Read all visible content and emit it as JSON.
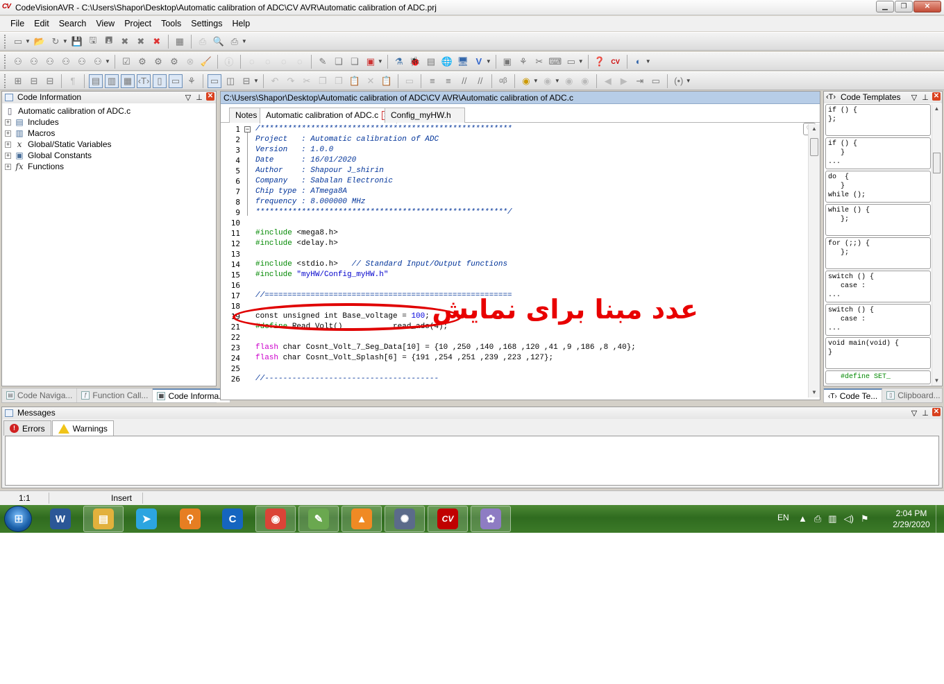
{
  "window": {
    "title": "CodeVisionAVR - C:\\Users\\Shapor\\Desktop\\Automatic calibration of ADC\\CV AVR\\Automatic calibration of ADC.prj",
    "app_icon_text": "CV"
  },
  "menu": [
    "File",
    "Edit",
    "Search",
    "View",
    "Project",
    "Tools",
    "Settings",
    "Help"
  ],
  "code_info_panel": {
    "title": "Code Information",
    "root": "Automatic calibration of ADC.c",
    "items": [
      {
        "label": "Includes",
        "icon": "includes-icon"
      },
      {
        "label": "Macros",
        "icon": "macros-icon"
      },
      {
        "label": "Global/Static Variables",
        "icon": "variable-icon",
        "glyph": "x"
      },
      {
        "label": "Global Constants",
        "icon": "constants-icon"
      },
      {
        "label": "Functions",
        "icon": "function-icon",
        "glyph": "fx"
      }
    ],
    "bottom_tabs": [
      "Code Naviga...",
      "Function Call...",
      "Code Informa..."
    ]
  },
  "editor": {
    "path": "C:\\Users\\Shapor\\Desktop\\Automatic calibration of ADC\\CV AVR\\Automatic calibration of ADC.c",
    "tabs": [
      "Notes",
      "Automatic calibration of ADC.c",
      "Config_myHW.h"
    ],
    "line_numbers": [
      "1",
      "2",
      "3",
      "4",
      "5",
      "6",
      "7",
      "8",
      "9",
      "10",
      "11",
      "12",
      "13",
      "14",
      "15",
      "16",
      "17",
      "18",
      "19",
      "21",
      "22",
      "23",
      "24",
      "25",
      "26"
    ],
    "lines": [
      {
        "n": "1",
        "parts": [
          {
            "t": "/*******************************************************",
            "c": "cmt"
          }
        ]
      },
      {
        "n": "2",
        "parts": [
          {
            "t": "Project   : Automatic calibration of ADC",
            "c": "cmt"
          }
        ]
      },
      {
        "n": "3",
        "parts": [
          {
            "t": "Version   : 1.0.0",
            "c": "cmt"
          }
        ]
      },
      {
        "n": "4",
        "parts": [
          {
            "t": "Date      : 16/01/2020",
            "c": "cmt"
          }
        ]
      },
      {
        "n": "5",
        "parts": [
          {
            "t": "Author    : Shapour J_shirin",
            "c": "cmt"
          }
        ]
      },
      {
        "n": "6",
        "parts": [
          {
            "t": "Company   : Sabalan Electronic",
            "c": "cmt"
          }
        ]
      },
      {
        "n": "7",
        "parts": [
          {
            "t": "Chip type : ATmega8A",
            "c": "cmt"
          }
        ]
      },
      {
        "n": "8",
        "parts": [
          {
            "t": "frequency : 8.000000 MHz",
            "c": "cmt"
          }
        ]
      },
      {
        "n": "9",
        "parts": [
          {
            "t": "*******************************************************/",
            "c": "cmt"
          }
        ]
      },
      {
        "n": "10",
        "parts": []
      },
      {
        "n": "11",
        "parts": [
          {
            "t": "#include ",
            "c": "dir"
          },
          {
            "t": "<mega8.h>",
            "c": ""
          }
        ]
      },
      {
        "n": "12",
        "parts": [
          {
            "t": "#include ",
            "c": "dir"
          },
          {
            "t": "<delay.h>",
            "c": ""
          }
        ]
      },
      {
        "n": "13",
        "parts": []
      },
      {
        "n": "14",
        "parts": [
          {
            "t": "#include ",
            "c": "dir"
          },
          {
            "t": "<stdio.h>   ",
            "c": ""
          },
          {
            "t": "// Standard Input/Output functions",
            "c": "cmt"
          }
        ]
      },
      {
        "n": "15",
        "parts": [
          {
            "t": "#include ",
            "c": "dir"
          },
          {
            "t": "\"myHW/Config_myHW.h\"",
            "c": "str"
          }
        ]
      },
      {
        "n": "16",
        "parts": []
      },
      {
        "n": "17",
        "parts": [
          {
            "t": "//======================================================",
            "c": "cmt"
          }
        ]
      },
      {
        "n": "18",
        "parts": []
      },
      {
        "n": "19",
        "parts": [
          {
            "t": "const unsigned int Base_voltage = ",
            "c": ""
          },
          {
            "t": "100",
            "c": "num"
          },
          {
            "t": ";",
            "c": ""
          }
        ]
      },
      {
        "n": "21",
        "parts": [
          {
            "t": "#define ",
            "c": "dir"
          },
          {
            "t": "Read_Volt()           read_adc(4);",
            "c": ""
          }
        ]
      },
      {
        "n": "22",
        "parts": []
      },
      {
        "n": "23",
        "parts": [
          {
            "t": "flash ",
            "c": "kw"
          },
          {
            "t": "char Cosnt_Volt_7_Seg_Data[10] = {10 ,250 ,140 ,168 ,120 ,41 ,9 ,186 ,8 ,40};",
            "c": ""
          }
        ]
      },
      {
        "n": "24",
        "parts": [
          {
            "t": "flash ",
            "c": "kw"
          },
          {
            "t": "char Cosnt_Volt_Splash[6] = {191 ,254 ,251 ,239 ,223 ,127};",
            "c": ""
          }
        ]
      },
      {
        "n": "25",
        "parts": []
      },
      {
        "n": "26",
        "parts": [
          {
            "t": "//--------------------------------------",
            "c": "cmt"
          }
        ]
      }
    ],
    "annotation": "عدد مبنا برای نمایش"
  },
  "templates_panel": {
    "title": "Code Templates",
    "items": [
      "if () {\n};",
      "if () {\n   }\n...",
      "do  {\n   }\nwhile ();",
      "while () {\n   };",
      "for (;;) {\n   };",
      "switch () {\n   case :\n...",
      "switch () {\n   case :\n...",
      "void main(void) {\n}",
      "   #define SET_"
    ],
    "bottom_tabs": [
      "Code Te...",
      "Clipboard..."
    ]
  },
  "messages": {
    "title": "Messages",
    "tabs": [
      "Errors",
      "Warnings"
    ]
  },
  "status": {
    "position": "1:1",
    "mode": "Insert"
  },
  "taskbar": {
    "apps": [
      {
        "name": "word",
        "label": "W",
        "color": "#2b5797"
      },
      {
        "name": "explorer",
        "label": "▤",
        "color": "#e2b13c"
      },
      {
        "name": "telegram",
        "label": "➤",
        "color": "#2ca5e0"
      },
      {
        "name": "search-tool",
        "label": "⚲",
        "color": "#e67e22"
      },
      {
        "name": "ccleaner",
        "label": "C",
        "color": "#1565c0"
      },
      {
        "name": "chrome",
        "label": "◉",
        "color": "#db4437"
      },
      {
        "name": "greenshot",
        "label": "✎",
        "color": "#6aa84f"
      },
      {
        "name": "vlc",
        "label": "▲",
        "color": "#f08a24"
      },
      {
        "name": "atom-app",
        "label": "✺",
        "color": "#5b6b8a"
      },
      {
        "name": "codevision",
        "label": "CV",
        "color": "#c00000"
      },
      {
        "name": "paint",
        "label": "✿",
        "color": "#8e7cc3"
      }
    ],
    "lang": "EN",
    "time": "2:04 PM",
    "date": "2/29/2020"
  }
}
